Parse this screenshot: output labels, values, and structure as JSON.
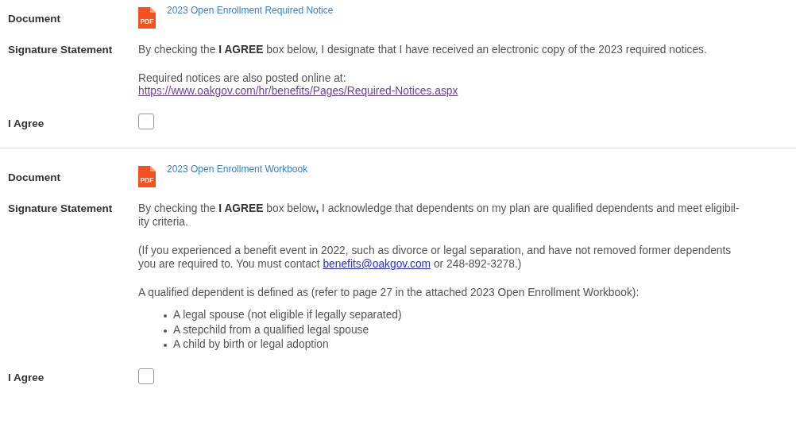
{
  "sections": [
    {
      "document": {
        "label": "Document",
        "icon_text": "PDF",
        "link": "2023 Open Enrollment Required Notice"
      },
      "statement": {
        "label": "Signature Statement",
        "paragraphs": [
          {
            "kind": "text",
            "text": "By checking the **I AGREE** box below, I designate that I have received an electronic copy of the 2023 required notices."
          },
          {
            "kind": "text",
            "text": "Required notices are also posted online at:"
          },
          {
            "kind": "link",
            "text": "https://www.oakgov.com/hr/benefits/Pages/Required-Notices.aspx"
          }
        ]
      },
      "agree": {
        "label": "I Agree",
        "checked": false
      }
    },
    {
      "document": {
        "label": "Document",
        "icon_text": "PDF",
        "link": "2023 Open Enrollment Workbook"
      },
      "statement": {
        "label": "Signature Statement",
        "paragraphs": [
          {
            "kind": "text",
            "text": "By checking the **I AGREE** box below**,** I acknowledge that dependents on my plan are qualified dependents and meet eligibil-\nity criteria."
          },
          {
            "kind": "text_link",
            "before": "(If you experienced a benefit event in 2022, such as divorce or legal separation, and have not removed former dependents\nyou are required to. You must contact ",
            "link": "benefits@oakgov.com",
            "after": " or 248-892-3278.)"
          },
          {
            "kind": "text",
            "text": "A qualified dependent is defined as (refer to page 27 in the attached 2023 Open Enrollment Workbook):"
          },
          {
            "kind": "bullets",
            "items": [
              "A legal spouse (not eligible if legally separated)",
              "A stepchild from a qualified legal spouse",
              "A child by birth or legal adoption"
            ]
          }
        ]
      },
      "agree": {
        "label": "I Agree",
        "checked": false
      }
    }
  ]
}
